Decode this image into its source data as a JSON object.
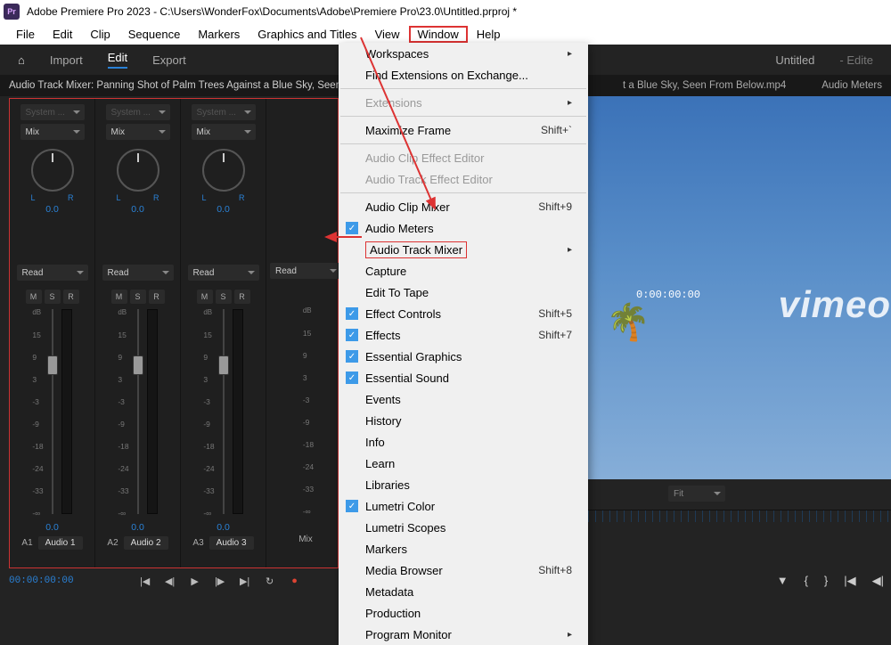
{
  "title_bar": "Adobe Premiere Pro 2023 - C:\\Users\\WonderFox\\Documents\\Adobe\\Premiere Pro\\23.0\\Untitled.prproj *",
  "logo_text": "Pr",
  "menu": {
    "file": "File",
    "edit": "Edit",
    "clip": "Clip",
    "sequence": "Sequence",
    "markers": "Markers",
    "graphics": "Graphics and Titles",
    "view": "View",
    "window": "Window",
    "help": "Help"
  },
  "tabs": {
    "import": "Import",
    "edit": "Edit",
    "export": "Export",
    "doc": "Untitled",
    "doc_state": "Edite"
  },
  "panel_titles": {
    "mixer": "Audio Track Mixer: Panning Shot of Palm Trees Against a Blue Sky, Seen F",
    "clip_right": "t a Blue Sky, Seen From Below.mp4",
    "audio_meters": "Audio Meters"
  },
  "channel": {
    "system": "System ...",
    "mix": "Mix",
    "L": "L",
    "R": "R",
    "knob_val": "0.0",
    "read": "Read",
    "M": "M",
    "S": "S",
    "Rbtn": "R",
    "db_top": "dB",
    "scale": [
      "15",
      "9",
      "3",
      "-3",
      "-9",
      "-18",
      "-24",
      "-33",
      "-∞"
    ],
    "scale_dB": "dB",
    "ch_val": "0.0",
    "a1": "A1",
    "a2": "A2",
    "a3": "A3",
    "audio1": "Audio 1",
    "audio2": "Audio 2",
    "audio3": "Audio 3",
    "mix_label": "Mix"
  },
  "transport_tc": "00:00:00:00",
  "preview": {
    "tc": "0:00:00:00",
    "vimeo": "vimeo"
  },
  "program": {
    "fit": "Fit"
  },
  "window_menu": {
    "workspaces": "Workspaces",
    "find_ext": "Find Extensions on Exchange...",
    "extensions": "Extensions",
    "maximize": "Maximize Frame",
    "maximize_sc": "Shift+`",
    "ace": "Audio Clip Effect Editor",
    "ate": "Audio Track Effect Editor",
    "acm": "Audio Clip Mixer",
    "acm_sc": "Shift+9",
    "am": "Audio Meters",
    "atm": "Audio Track Mixer",
    "capture": "Capture",
    "ett": "Edit To Tape",
    "ec": "Effect Controls",
    "ec_sc": "Shift+5",
    "eff": "Effects",
    "eff_sc": "Shift+7",
    "eg": "Essential Graphics",
    "es": "Essential Sound",
    "events": "Events",
    "history": "History",
    "info": "Info",
    "learn": "Learn",
    "libraries": "Libraries",
    "lc": "Lumetri Color",
    "ls": "Lumetri Scopes",
    "markers": "Markers",
    "mb": "Media Browser",
    "mb_sc": "Shift+8",
    "md": "Metadata",
    "prod": "Production",
    "pm": "Program Monitor"
  }
}
